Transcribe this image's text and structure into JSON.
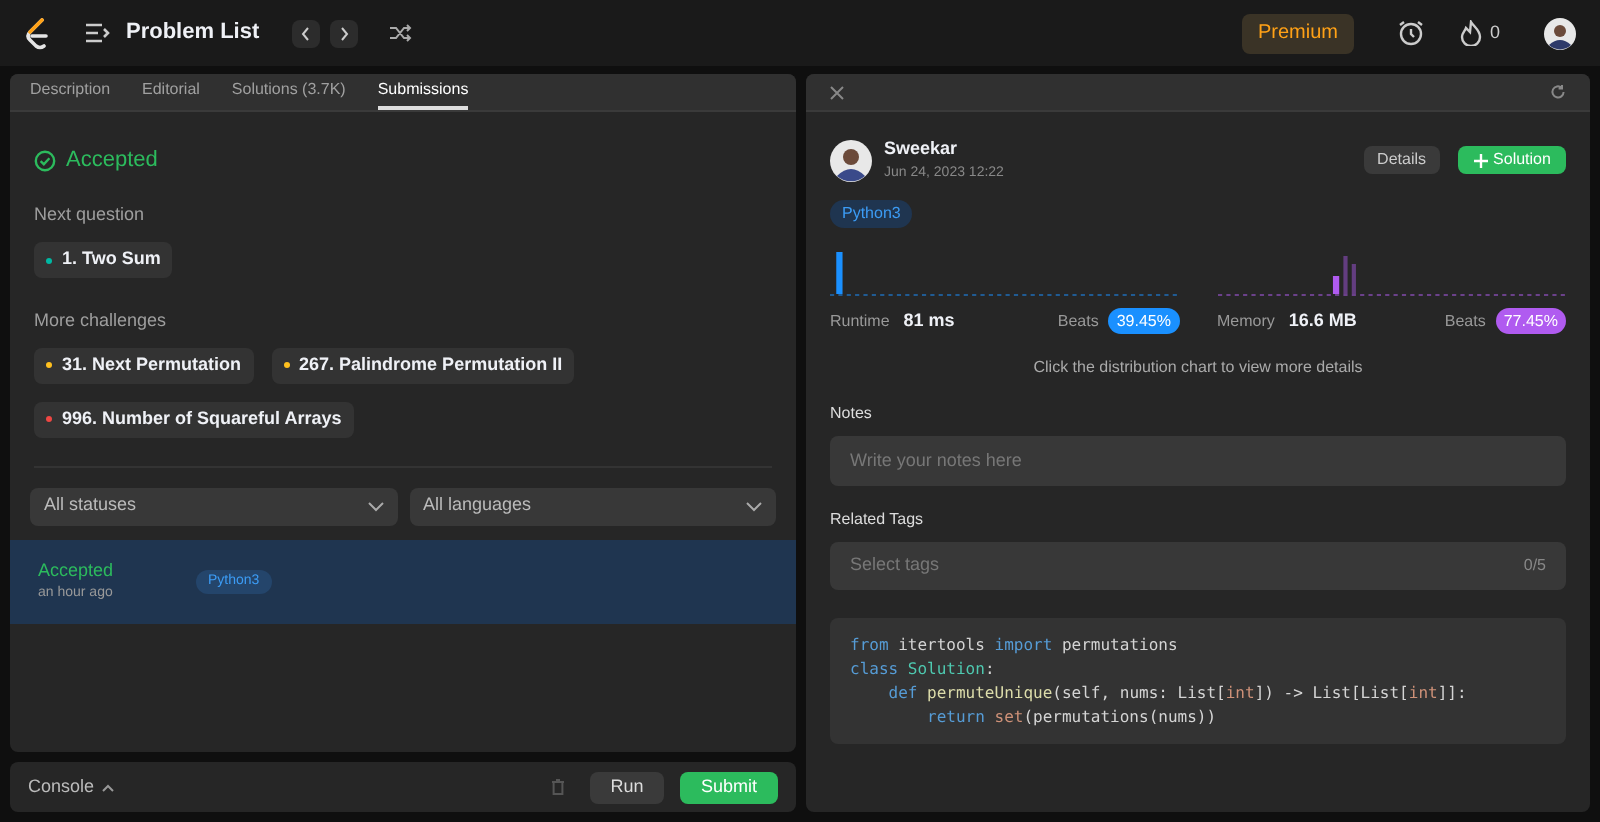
{
  "topbar": {
    "title": "Problem List",
    "premium": "Premium",
    "streak": "0"
  },
  "tabs": [
    {
      "label": "Description",
      "selected": false
    },
    {
      "label": "Editorial",
      "selected": false
    },
    {
      "label": "Solutions (3.7K)",
      "selected": false
    },
    {
      "label": "Submissions",
      "selected": true
    }
  ],
  "result": {
    "status": "Accepted"
  },
  "next_question": {
    "heading": "Next question",
    "items": [
      {
        "label": "1. Two Sum",
        "color": "#00b8a3"
      }
    ]
  },
  "more_challenges": {
    "heading": "More challenges",
    "items": [
      {
        "label": "31. Next Permutation",
        "color": "#ffc01e"
      },
      {
        "label": "267. Palindrome Permutation II",
        "color": "#ffc01e"
      },
      {
        "label": "996. Number of Squareful Arrays",
        "color": "#ef4743"
      }
    ]
  },
  "filters": [
    {
      "value": "All statuses"
    },
    {
      "value": "All languages"
    }
  ],
  "submissions": [
    {
      "status": "Accepted",
      "time": "an hour ago",
      "language": "Python3",
      "selected": true
    }
  ],
  "console": {
    "label": "Console",
    "run": "Run",
    "submit": "Submit"
  },
  "detail": {
    "user": {
      "name": "Sweekar",
      "date": "Jun 24, 2023 12:22"
    },
    "details_button": "Details",
    "solution_button": "Solution",
    "language": "Python3",
    "stats": [
      {
        "label": "Runtime",
        "value": "81 ms",
        "beats_label": "Beats",
        "beats": "39.45%",
        "color": "#1a90ff"
      },
      {
        "label": "Memory",
        "value": "16.6 MB",
        "beats_label": "Beats",
        "beats": "77.45%",
        "color": "#b05bf0"
      }
    ],
    "hint": "Click the distribution chart to view more details",
    "notes": {
      "label": "Notes",
      "placeholder": "Write your notes here"
    },
    "tags": {
      "label": "Related Tags",
      "placeholder": "Select tags",
      "count": "0/5"
    },
    "code": [
      [
        {
          "text": "from",
          "kind": "keyword"
        },
        {
          "text": " itertools ",
          "kind": "plain"
        },
        {
          "text": "import",
          "kind": "keyword"
        },
        {
          "text": " permutations",
          "kind": "plain"
        }
      ],
      [
        {
          "text": "class",
          "kind": "keyword"
        },
        {
          "text": " Solution",
          "kind": "class"
        },
        {
          "text": ":",
          "kind": "plain"
        }
      ],
      [
        {
          "text": "    def",
          "kind": "keyword"
        },
        {
          "text": " permuteUnique",
          "kind": "function"
        },
        {
          "text": "(self, nums: List[",
          "kind": "plain"
        },
        {
          "text": "int",
          "kind": "builtin"
        },
        {
          "text": "]) -> List[List[",
          "kind": "plain"
        },
        {
          "text": "int",
          "kind": "builtin"
        },
        {
          "text": "]]:",
          "kind": "plain"
        }
      ],
      [
        {
          "text": "        return",
          "kind": "keyword"
        },
        {
          "text": " set",
          "kind": "builtin"
        },
        {
          "text": "(permutations(nums))",
          "kind": "plain"
        }
      ]
    ]
  }
}
